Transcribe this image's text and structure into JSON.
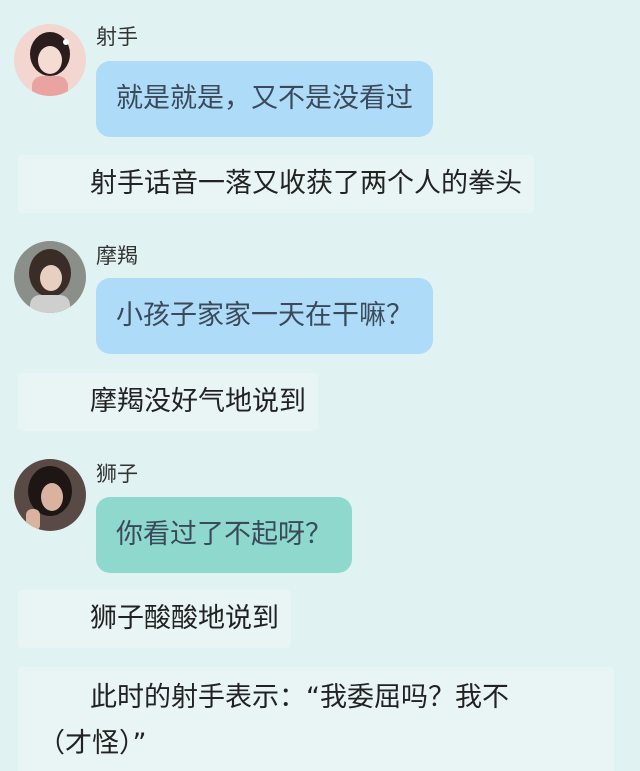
{
  "messages": [
    {
      "name": "射手",
      "text": "就是就是，又不是没看过",
      "bubble_color": "#aedbf8",
      "avatar": "sagittarius-avatar"
    },
    {
      "name": "摩羯",
      "text": "小孩子家家一天在干嘛？",
      "bubble_color": "#aedbf8",
      "avatar": "capricorn-avatar"
    },
    {
      "name": "狮子",
      "text": "你看过了不起呀？",
      "bubble_color": "#8ed8cd",
      "avatar": "leo-avatar"
    }
  ],
  "narrations": [
    "射手话音一落又收获了两个人的拳头",
    "摩羯没好气地说到",
    "狮子酸酸地说到",
    "此时的射手表示：“我委屈吗？我不（才怪）”"
  ],
  "narration_lines": {
    "line1": "此时的射手表示：“我委屈吗？我不",
    "line2": "（才怪）”"
  },
  "colors": {
    "background": "#e0f2f1",
    "bubble_blue": "#aedbf8",
    "bubble_teal": "#8ed8cd",
    "narration_bg": "#e8f5f4"
  }
}
